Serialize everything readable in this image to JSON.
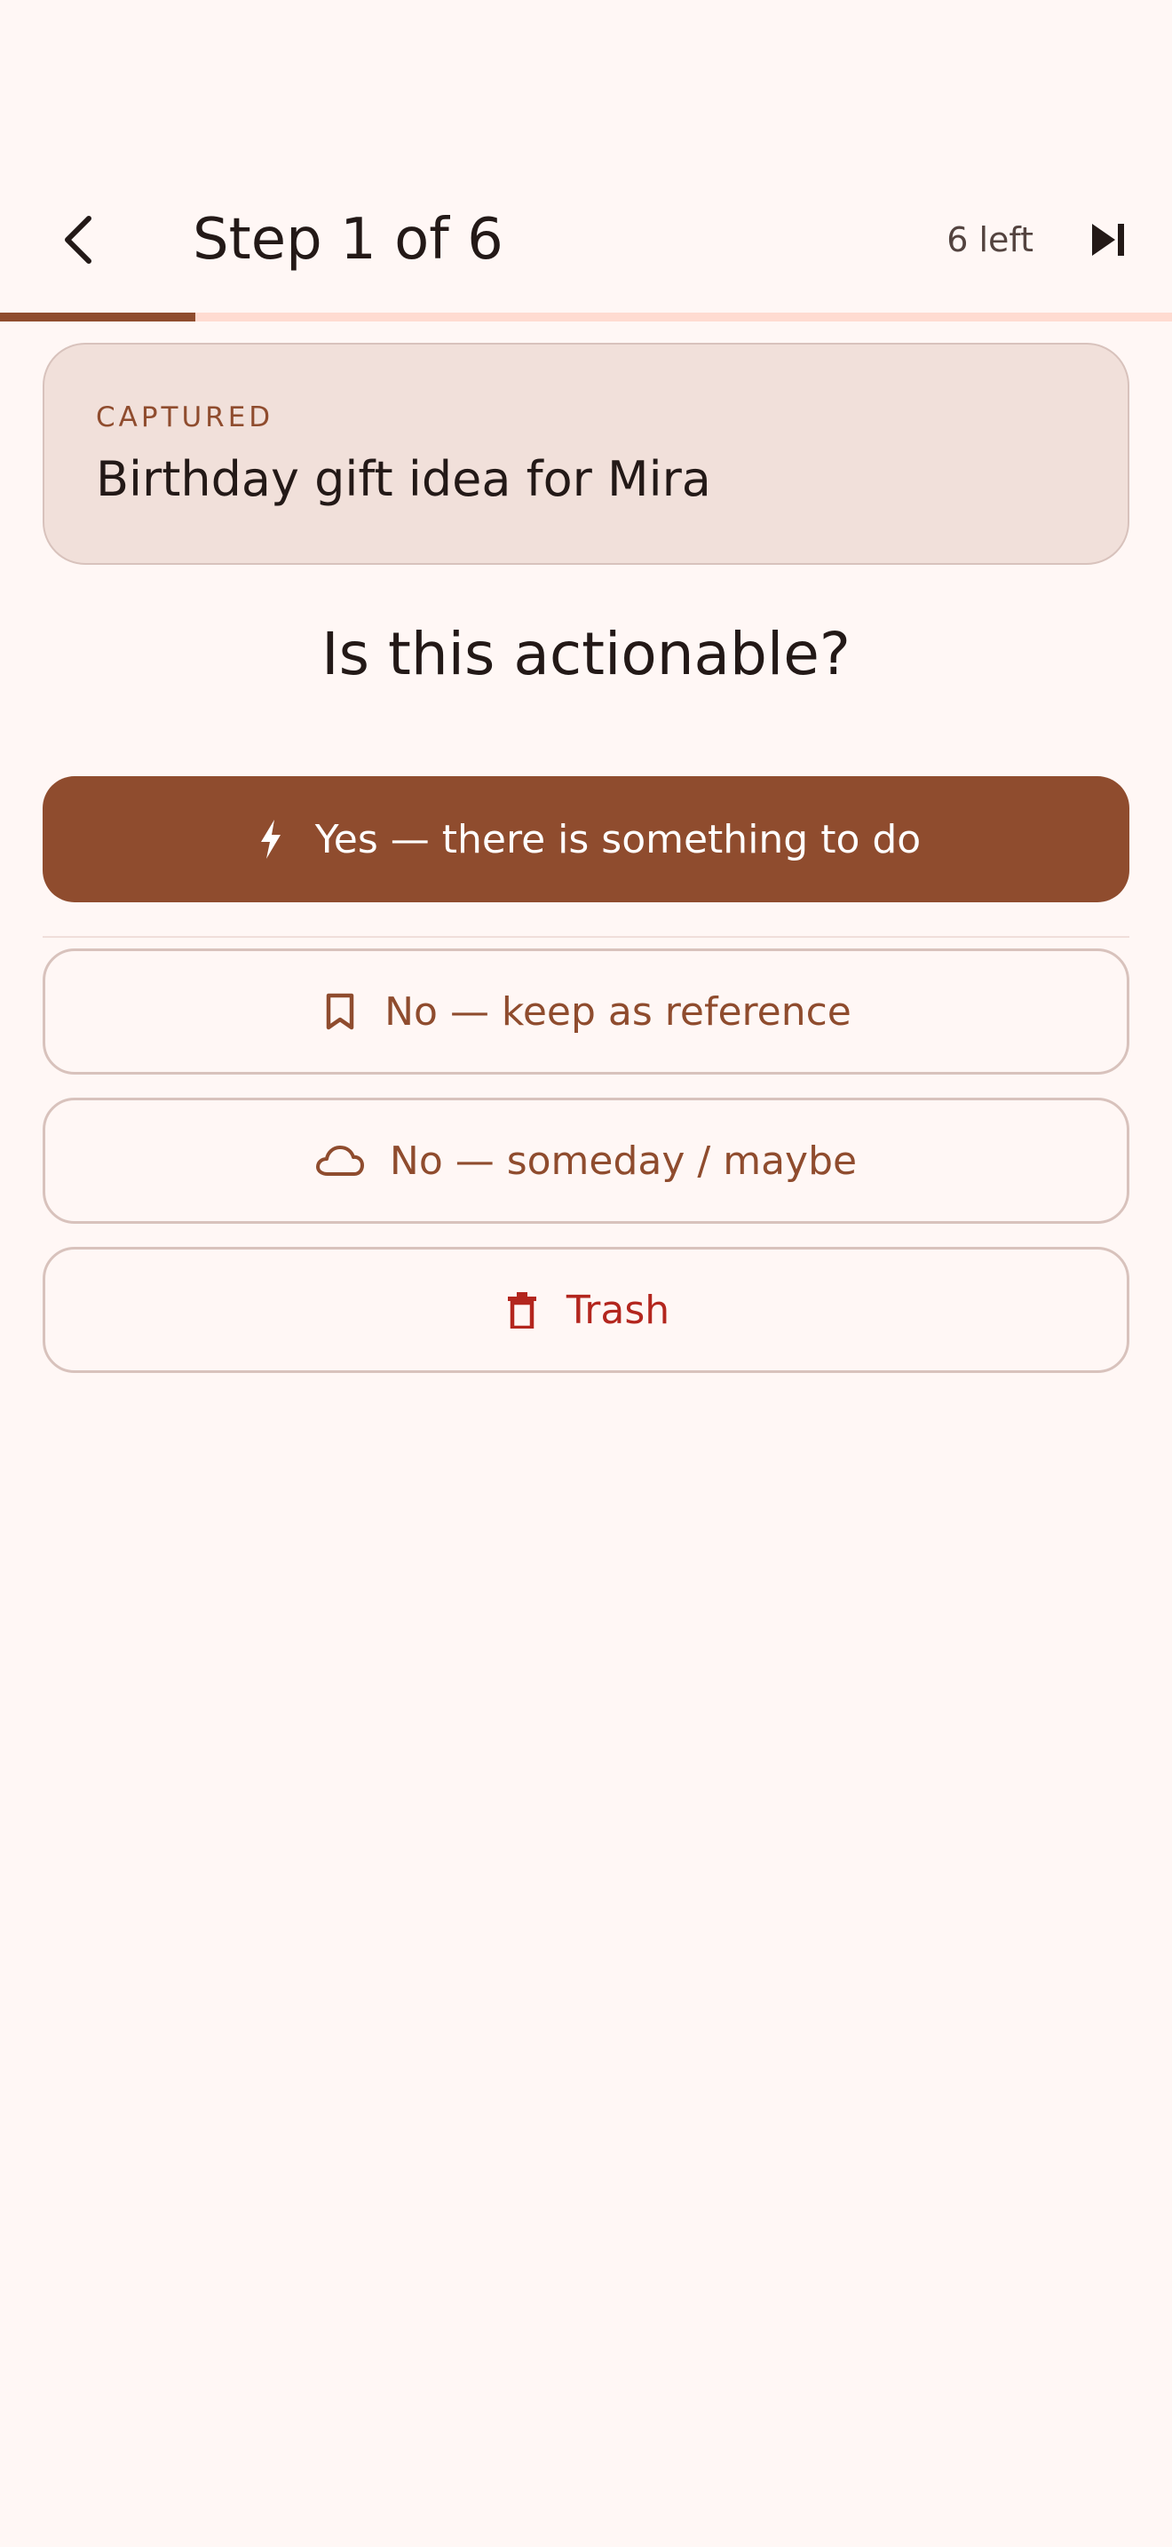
{
  "app_bar": {
    "title": "Step 1 of 6",
    "remaining_label": "6 left",
    "back_icon": "chevron-left-icon",
    "skip_icon": "skip-next-icon"
  },
  "progress": {
    "fraction": 0.1667,
    "track_color": "#FFDBD1",
    "fill_color": "#8F4C2E"
  },
  "captured": {
    "label": "CAPTURED",
    "text": "Birthday gift idea for Mira"
  },
  "question": "Is this actionable?",
  "options": {
    "yes": {
      "label": "Yes — there is something to do",
      "icon": "bolt-icon"
    },
    "reference": {
      "label": "No — keep as reference",
      "icon": "bookmark-icon"
    },
    "someday": {
      "label": "No — someday / maybe",
      "icon": "cloud-icon"
    },
    "trash": {
      "label": "Trash",
      "icon": "trash-icon"
    }
  },
  "colors": {
    "primary": "#8F4C2E",
    "background": "#FFF7F5",
    "error": "#B3261E",
    "on_surface": "#231917"
  }
}
